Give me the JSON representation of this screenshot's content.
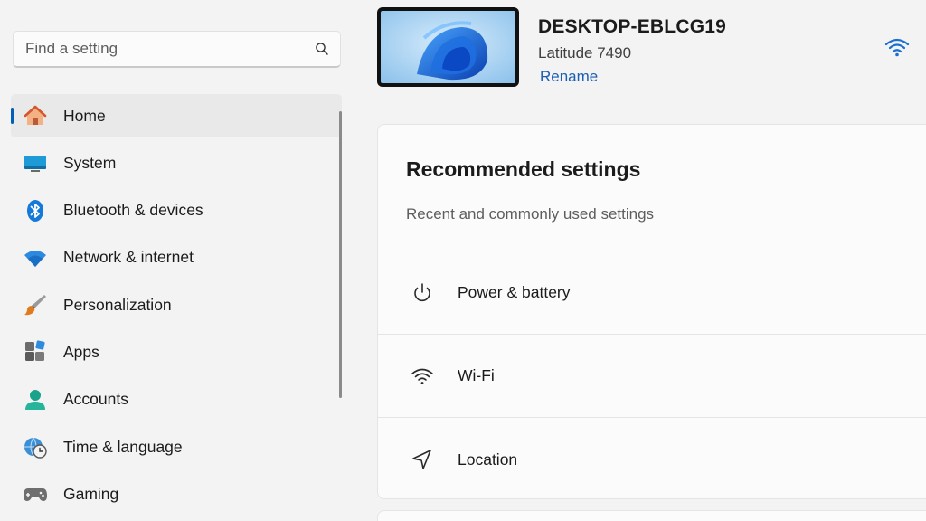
{
  "search": {
    "placeholder": "Find a setting",
    "icon": "search-icon"
  },
  "sidebar": {
    "items": [
      {
        "label": "Home",
        "icon": "home-icon",
        "selected": true
      },
      {
        "label": "System",
        "icon": "system-icon"
      },
      {
        "label": "Bluetooth & devices",
        "icon": "bluetooth-icon"
      },
      {
        "label": "Network & internet",
        "icon": "wifi-icon"
      },
      {
        "label": "Personalization",
        "icon": "brush-icon"
      },
      {
        "label": "Apps",
        "icon": "apps-icon"
      },
      {
        "label": "Accounts",
        "icon": "account-icon"
      },
      {
        "label": "Time & language",
        "icon": "globe-clock-icon"
      },
      {
        "label": "Gaming",
        "icon": "controller-icon"
      }
    ]
  },
  "device": {
    "name": "DESKTOP-EBLCG19",
    "model": "Latitude 7490",
    "rename_label": "Rename",
    "status_icon": "wifi-status-icon"
  },
  "recommended": {
    "title": "Recommended settings",
    "subtitle": "Recent and commonly used settings",
    "items": [
      {
        "label": "Power & battery",
        "icon": "power-icon"
      },
      {
        "label": "Wi-Fi",
        "icon": "wifi-icon"
      },
      {
        "label": "Location",
        "icon": "location-icon"
      }
    ]
  },
  "colors": {
    "accent": "#005fb8",
    "link": "#1a5fb4",
    "background": "#f3f3f3",
    "card": "#fbfbfb"
  }
}
